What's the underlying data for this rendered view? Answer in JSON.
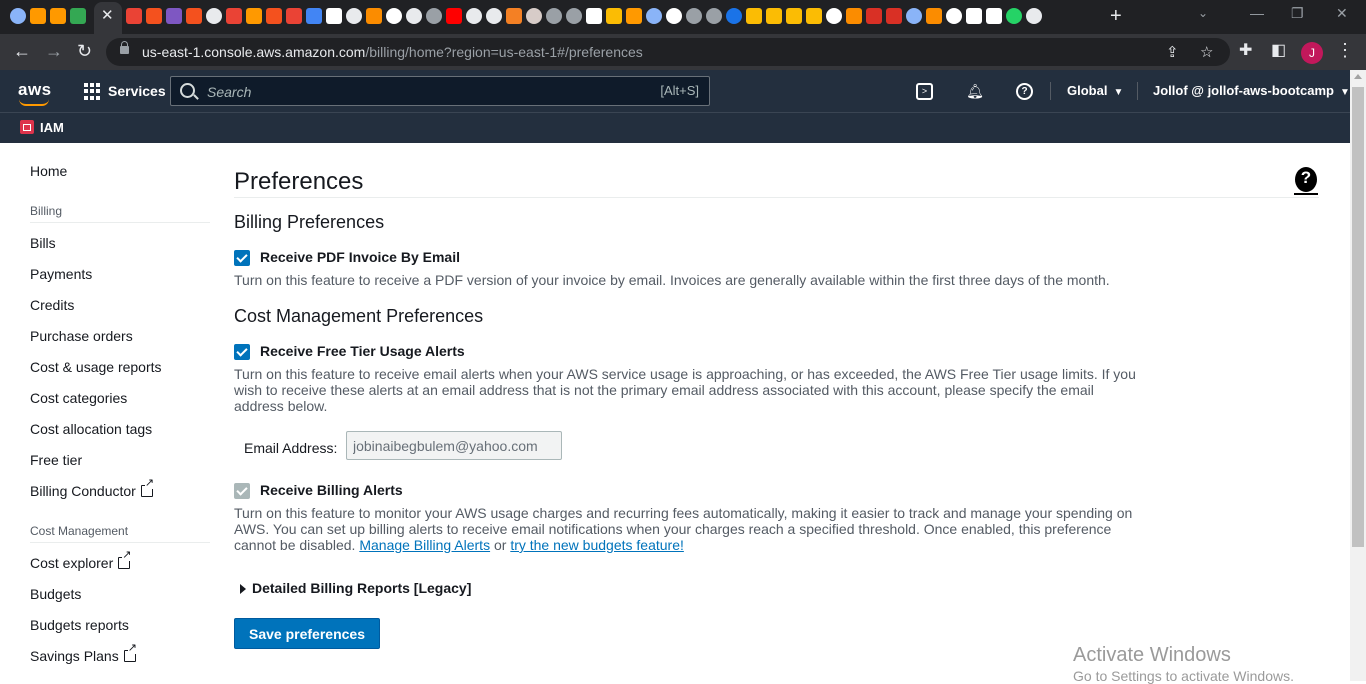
{
  "browser": {
    "tab_close": "✕",
    "new_tab": "+",
    "back": "←",
    "forward": "→",
    "reload": "↻",
    "url_host": "us-east-1.console.aws.amazon.com",
    "url_path": "/billing/home?region=us-east-1#/preferences",
    "profile_initial": "J",
    "tab_icons": [
      "chrome-icon",
      "amazon-icon",
      "amazon-icon",
      "tree-icon",
      "gmail-icon",
      "chart-icon",
      "purple-icon",
      "chart-icon",
      "github-icon",
      "gmail-icon",
      "amazon-icon",
      "chart-icon",
      "gmail-icon",
      "docs-icon",
      "wikipedia-icon",
      "github-icon",
      "orange-icon",
      "google-icon",
      "github-icon",
      "globe-icon",
      "youtube-icon",
      "github-icon",
      "github-icon",
      "stack-icon",
      "avatar-icon",
      "globe-icon",
      "globe-icon",
      "medium-icon",
      "box-icon",
      "amazon-icon",
      "chrome-icon",
      "google-icon",
      "globe-icon",
      "globe-icon",
      "onepassword-icon",
      "box-icon",
      "box-icon",
      "box-icon",
      "box-icon",
      "google-icon",
      "orange-icon",
      "asterisk-icon",
      "red-icon",
      "chrome-icon",
      "orange-icon",
      "google-icon",
      "medium-icon",
      "medium-icon",
      "whatsapp-icon",
      "github-icon"
    ]
  },
  "aws_header": {
    "logo": "aws",
    "services": "Services",
    "search_placeholder": "Search",
    "search_shortcut": "[Alt+S]",
    "region": "Global",
    "account": "Jollof @ jollof-aws-bootcamp",
    "service_label": "IAM"
  },
  "sidebar": {
    "home": "Home",
    "billing_heading": "Billing",
    "billing_items": [
      "Bills",
      "Payments",
      "Credits",
      "Purchase orders",
      "Cost & usage reports",
      "Cost categories",
      "Cost allocation tags",
      "Free tier",
      "Billing Conductor"
    ],
    "cost_heading": "Cost Management",
    "cost_items": [
      "Cost explorer",
      "Budgets",
      "Budgets reports",
      "Savings Plans"
    ]
  },
  "main": {
    "title": "Preferences",
    "billing_prefs_heading": "Billing Preferences",
    "pdf_label": "Receive PDF Invoice By Email",
    "pdf_desc": "Turn on this feature to receive a PDF version of your invoice by email. Invoices are generally available within the first three days of the month.",
    "cost_prefs_heading": "Cost Management Preferences",
    "free_tier_label": "Receive Free Tier Usage Alerts",
    "free_tier_desc": "Turn on this feature to receive email alerts when your AWS service usage is approaching, or has exceeded, the AWS Free Tier usage limits. If you wish to receive these alerts at an email address that is not the primary email address associated with this account, please specify the email address below.",
    "email_label": "Email Address:",
    "email_value": "jobinaibegbulem@yahoo.com",
    "billing_alerts_label": "Receive Billing Alerts",
    "billing_alerts_desc": "Turn on this feature to monitor your AWS usage charges and recurring fees automatically, making it easier to track and manage your spending on AWS. You can set up billing alerts to receive email notifications when your charges reach a specified threshold. Once enabled, this preference cannot be disabled.",
    "manage_alerts_link": "Manage Billing Alerts",
    "or_text": "or",
    "budgets_link": "try the new budgets feature!",
    "legacy_label": "Detailed Billing Reports [Legacy]",
    "save_button": "Save preferences"
  },
  "watermark": {
    "title": "Activate Windows",
    "subtitle": "Go to Settings to activate Windows."
  },
  "colors": {
    "aws_nav": "#232f3e",
    "aws_orange": "#ff9900",
    "primary_blue": "#0073bb",
    "browser_dark": "#202124"
  }
}
